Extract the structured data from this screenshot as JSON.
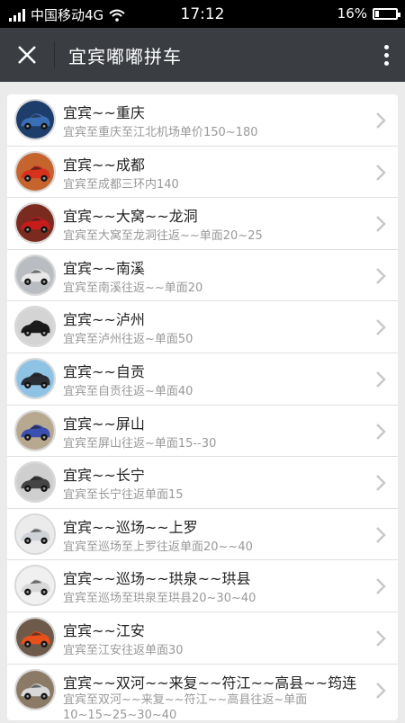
{
  "status_bar": {
    "carrier": "中国移动4G",
    "time": "17:12",
    "battery": "16%"
  },
  "header": {
    "title": "宜宾嘟嘟拼车"
  },
  "routes": [
    {
      "title": "宜宾~~重庆",
      "subtitle": "宜宾至重庆至江北机场单价150~180",
      "car_color": "#3a6fb8",
      "bg": "#1d3d6a"
    },
    {
      "title": "宜宾~~成都",
      "subtitle": "宜宾至成都三环内140",
      "car_color": "#d8321e",
      "bg": "#c6642e"
    },
    {
      "title": "宜宾~~大窝~~龙洞",
      "subtitle": "宜宾至大窝至龙洞往返~~单面20~25",
      "car_color": "#c81c1c",
      "bg": "#7a2a1e"
    },
    {
      "title": "宜宾~~南溪",
      "subtitle": "宜宾至南溪往返~~单面20",
      "car_color": "#e8e8e8",
      "bg": "#b9bcc0"
    },
    {
      "title": "宜宾~~泸州",
      "subtitle": "宜宾至泸州往返~单面50",
      "car_color": "#1a1a1a",
      "bg": "#d4d4d4"
    },
    {
      "title": "宜宾~~自贡",
      "subtitle": "宜宾至自贡往返~单面40",
      "car_color": "#2a2d33",
      "bg": "#8fc3e6"
    },
    {
      "title": "宜宾~~屏山",
      "subtitle": "宜宾至屏山往返~单面15--30",
      "car_color": "#3a4fb0",
      "bg": "#b7a890"
    },
    {
      "title": "宜宾~~长宁",
      "subtitle": "宜宾至长宁往返单面15",
      "car_color": "#444444",
      "bg": "#cfcfcf"
    },
    {
      "title": "宜宾~~巡场~~上罗",
      "subtitle": "宜宾至巡场至上罗往返单面20~~40",
      "car_color": "#cfd2d6",
      "bg": "#ebebeb"
    },
    {
      "title": "宜宾~~巡场~~珙泉~~珙县",
      "subtitle": "宜宾至巡场至珙泉至珙县20~30~40",
      "car_color": "#d8d8d8",
      "bg": "#f0f0f0"
    },
    {
      "title": "宜宾~~江安",
      "subtitle": "宜宾至江安往返单面30",
      "car_color": "#e8501c",
      "bg": "#6e5a4a"
    },
    {
      "title": "宜宾~~双河~~来复~~符江~~高县~~筠连",
      "subtitle": "宜宾至双河~~来复~~符江~~高县往返~单面10~15~25~30~40",
      "car_color": "#d8d8d8",
      "bg": "#8a7a66"
    }
  ]
}
